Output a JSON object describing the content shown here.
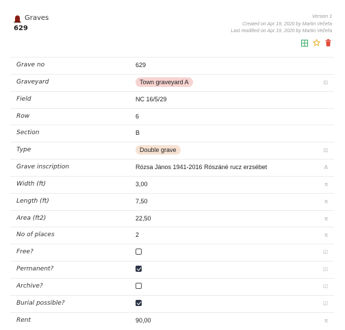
{
  "header": {
    "table_name": "Graves",
    "record_id": "629",
    "version": "Version 1",
    "created": "Created on Apr 19, 2020 by Martin Večeřa",
    "modified": "Last modified on Apr 19, 2020 by Martin Večeřa",
    "colors": {
      "grid_icon": "#3aa864",
      "star_icon": "#e6a817",
      "trash_icon": "#e04a3a",
      "table_icon": "#8a1c12"
    }
  },
  "fields": [
    {
      "label": "Grave no",
      "kind": "text",
      "value": "629",
      "type_icon": ""
    },
    {
      "label": "Graveyard",
      "kind": "badge",
      "value": "Town graveyard A",
      "badge_color": "#f6d3d1",
      "type_icon": "⊡"
    },
    {
      "label": "Field",
      "kind": "text",
      "value": "NC 16/5/29",
      "type_icon": ""
    },
    {
      "label": "Row",
      "kind": "text",
      "value": "6",
      "type_icon": ""
    },
    {
      "label": "Section",
      "kind": "text",
      "value": "B",
      "type_icon": ""
    },
    {
      "label": "Type",
      "kind": "badge",
      "value": "Double grave",
      "badge_color": "#f6e2d3",
      "type_icon": "⊡"
    },
    {
      "label": "Grave inscription",
      "kind": "text",
      "value": "Rózsa János 1941-2016 Rószáné rucz erzsébet",
      "type_icon": "A"
    },
    {
      "label": "Width (ft)",
      "kind": "text",
      "value": "3,00",
      "type_icon": "π"
    },
    {
      "label": "Length (ft)",
      "kind": "text",
      "value": "7,50",
      "type_icon": "π"
    },
    {
      "label": "Area (ft2)",
      "kind": "text",
      "value": "22,50",
      "type_icon": "π"
    },
    {
      "label": "No of places",
      "kind": "text",
      "value": "2",
      "type_icon": "π"
    },
    {
      "label": "Free?",
      "kind": "checkbox",
      "checked": false,
      "type_icon": "☑"
    },
    {
      "label": "Permanent?",
      "kind": "checkbox",
      "checked": true,
      "type_icon": "☑"
    },
    {
      "label": "Archive?",
      "kind": "checkbox",
      "checked": false,
      "type_icon": "☑"
    },
    {
      "label": "Burial possible?",
      "kind": "checkbox",
      "checked": true,
      "type_icon": "☑"
    },
    {
      "label": "Rent",
      "kind": "text",
      "value": "90,00",
      "type_icon": "π"
    }
  ]
}
